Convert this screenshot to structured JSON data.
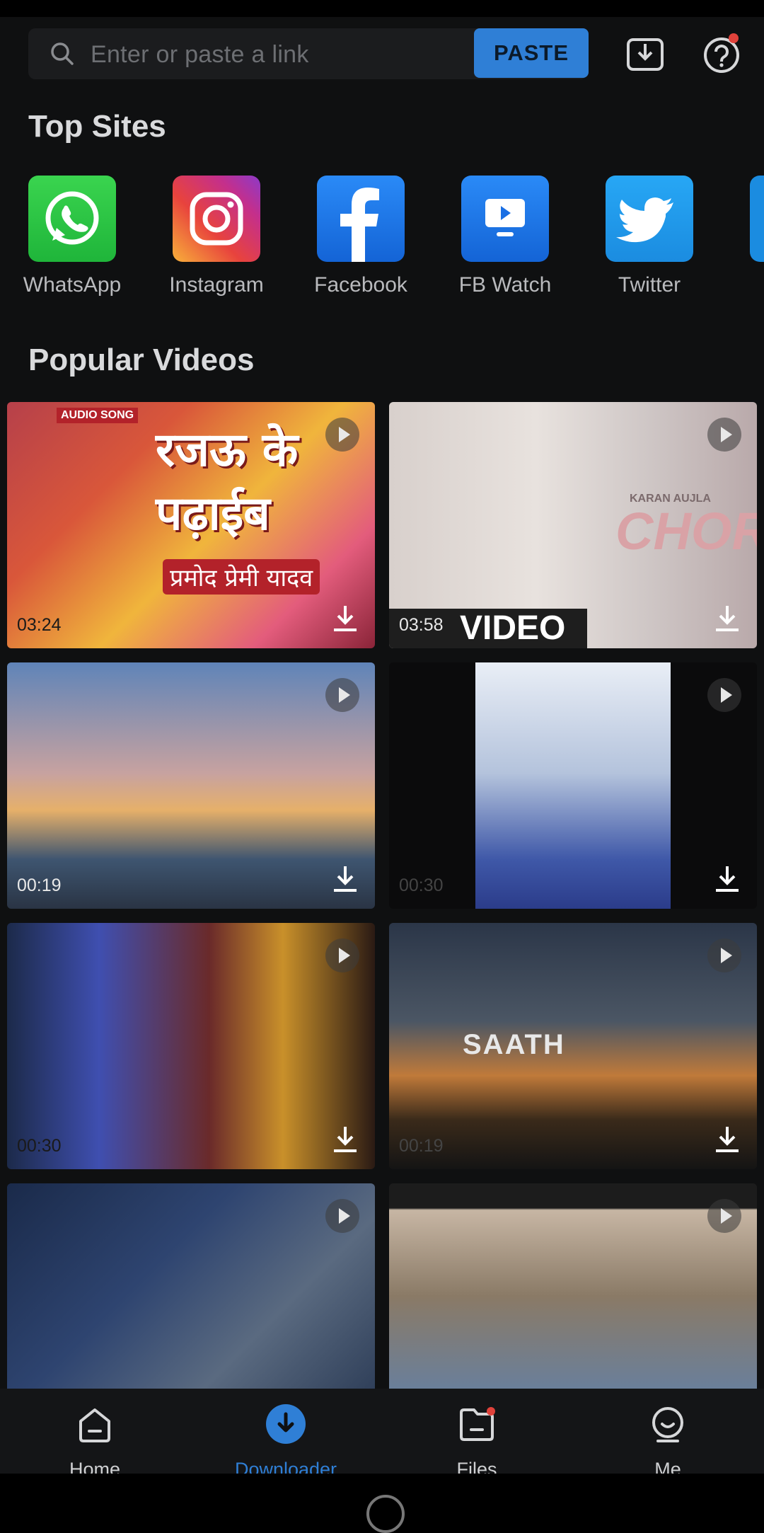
{
  "search": {
    "placeholder": "Enter or paste a link",
    "paste_label": "PASTE"
  },
  "top_sites": {
    "title": "Top Sites",
    "items": [
      {
        "label": "WhatsApp",
        "icon": "whatsapp-icon",
        "color": "#25c93f"
      },
      {
        "label": "Instagram",
        "icon": "instagram-icon",
        "color": "#d6307a"
      },
      {
        "label": "Facebook",
        "icon": "facebook-icon",
        "color": "#1877f2"
      },
      {
        "label": "FB Watch",
        "icon": "fb-watch-icon",
        "color": "#1877f2"
      },
      {
        "label": "Twitter",
        "icon": "twitter-icon",
        "color": "#1da1f2"
      }
    ]
  },
  "popular": {
    "title": "Popular Videos",
    "videos": [
      {
        "duration": "03:24",
        "thumb_text": "रजऊ के पढ़ाईब",
        "thumb_sub": "प्रमोद प्रेमी यादव",
        "badge": "AUDIO SONG"
      },
      {
        "duration": "03:58",
        "thumb_text": "CHOR",
        "thumb_sub": "KARAN AUJLA",
        "badge": "VIDEO"
      },
      {
        "duration": "00:19",
        "thumb_text": "",
        "thumb_sub": "",
        "badge": ""
      },
      {
        "duration": "00:30",
        "thumb_text": "",
        "thumb_sub": "",
        "badge": ""
      },
      {
        "duration": "00:30",
        "thumb_text": "",
        "thumb_sub": "",
        "badge": ""
      },
      {
        "duration": "00:19",
        "thumb_text": "SAATH",
        "thumb_sub": "",
        "badge": ""
      },
      {
        "duration": "",
        "thumb_text": "",
        "thumb_sub": "",
        "badge": ""
      },
      {
        "duration": "",
        "thumb_text": "",
        "thumb_sub": "",
        "badge": ""
      }
    ]
  },
  "nav": {
    "items": [
      {
        "label": "Home",
        "icon": "home-icon"
      },
      {
        "label": "Downloader",
        "icon": "downloader-icon"
      },
      {
        "label": "Files",
        "icon": "files-icon"
      },
      {
        "label": "Me",
        "icon": "me-icon"
      }
    ],
    "active_color": "#2f7fd6"
  }
}
